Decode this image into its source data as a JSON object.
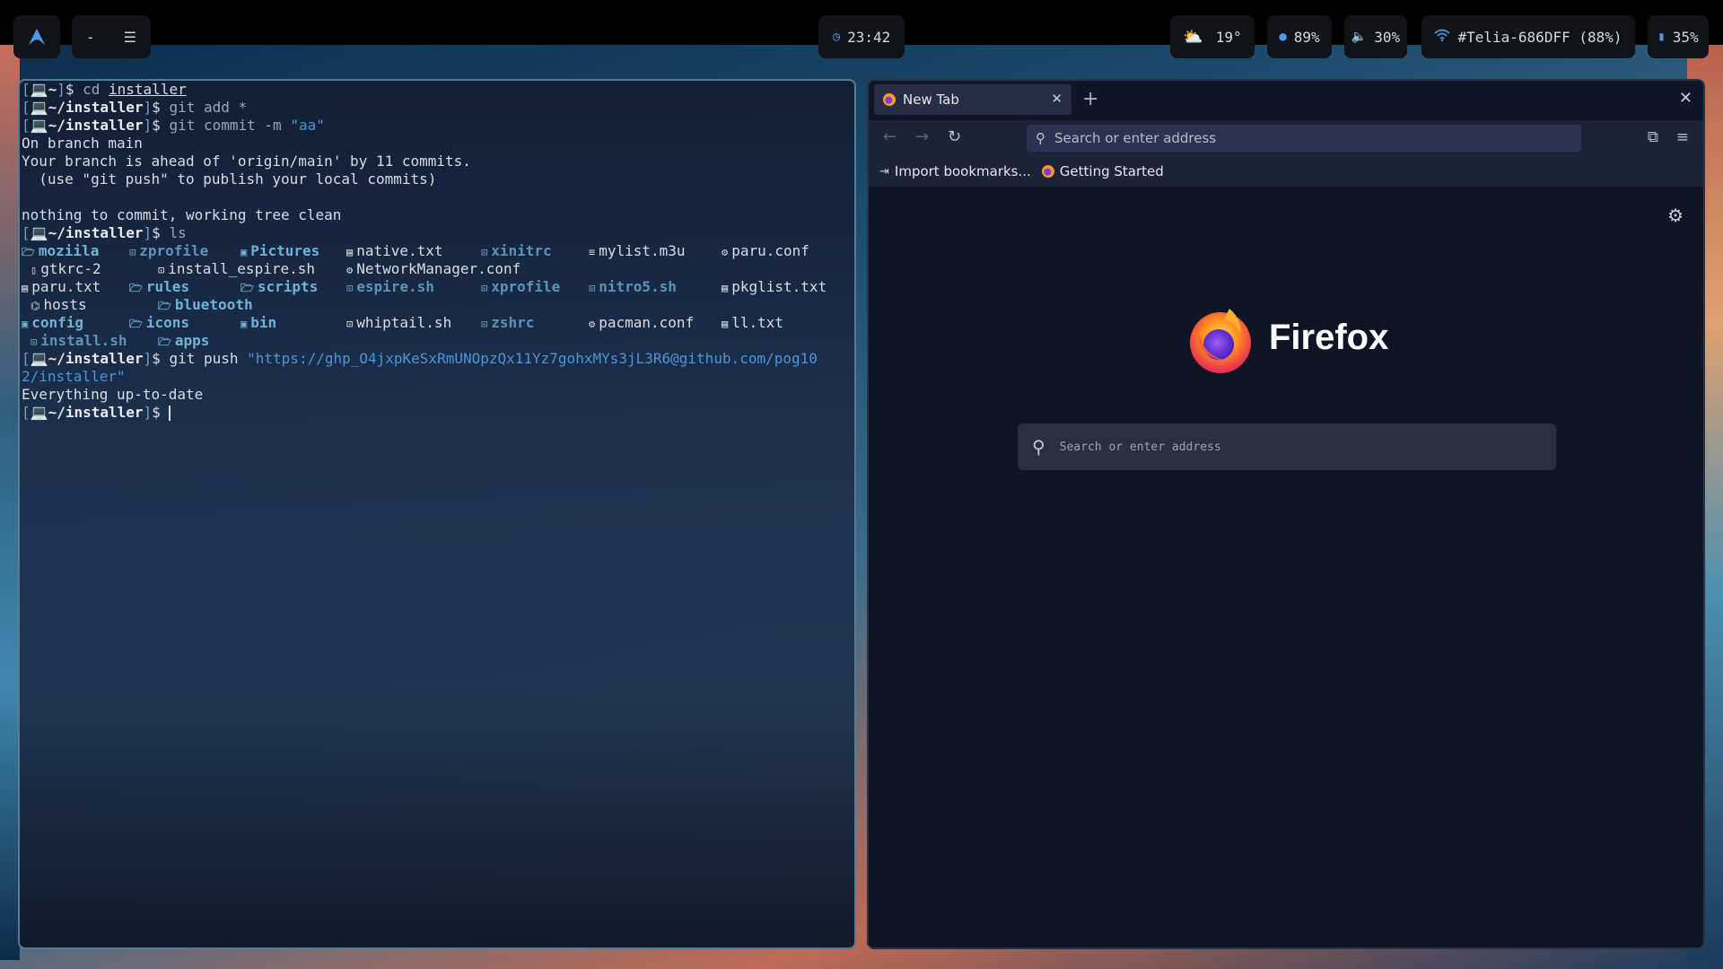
{
  "topbar": {
    "launcher_icon": "arch-logo-icon",
    "workspace": {
      "minimize": "-",
      "menu": "☰"
    },
    "clock": {
      "icon": "clock-icon",
      "time": "23:42"
    },
    "weather": {
      "icon": "cloud-sun-icon",
      "temp": "19°"
    },
    "cpu": {
      "icon": "circle-icon",
      "value": "89%"
    },
    "volume": {
      "icon": "speaker-icon",
      "value": "30%"
    },
    "wifi": {
      "icon": "wifi-icon",
      "value": "#Telia-686DFF (88%)"
    },
    "battery": {
      "icon": "battery-icon",
      "value": "35%"
    },
    "accent": "#4a9be8"
  },
  "terminal": {
    "prompt_home": "~",
    "prompt_dir": "~/installer",
    "lines": {
      "l1_cmd": "cd",
      "l1_arg": "installer",
      "l2_cmd": "git add *",
      "l3_cmd": "git commit -m",
      "l3_arg": "\"aa\"",
      "l4": "On branch main",
      "l5": "Your branch is ahead of 'origin/main' by 11 commits.",
      "l6": "  (use \"git push\" to publish your local commits)",
      "l7": "nothing to commit, working tree clean",
      "l8_cmd": "ls",
      "push_cmd": "git push",
      "push_url_1": "\"https://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@github.com/pog10",
      "push_url_2": "2/installer\"",
      "push_result": "Everything up-to-date"
    },
    "ls": [
      [
        "moziila",
        "zprofile",
        "Pictures",
        "native.txt",
        "xinitrc",
        "mylist.m3u",
        "paru.conf"
      ],
      [
        "gtkrc-2",
        "install_espire.sh",
        "NetworkManager.conf"
      ],
      [
        "paru.txt",
        "rules",
        "scripts",
        "espire.sh",
        "xprofile",
        "nitro5.sh",
        "pkglist.txt"
      ],
      [
        "hosts",
        "bluetooth"
      ],
      [
        "config",
        "icons",
        "bin",
        "whiptail.sh",
        "zshrc",
        "pacman.conf",
        "ll.txt"
      ],
      [
        "install.sh",
        "apps"
      ]
    ]
  },
  "firefox": {
    "tab_title": "New Tab",
    "tab_close": "✕",
    "new_tab": "+",
    "window_close": "✕",
    "url_placeholder": "Search or enter address",
    "bookmarks": [
      "Import bookmarks...",
      "Getting Started"
    ],
    "brand": "Firefox",
    "search_placeholder": "Search or enter address"
  }
}
